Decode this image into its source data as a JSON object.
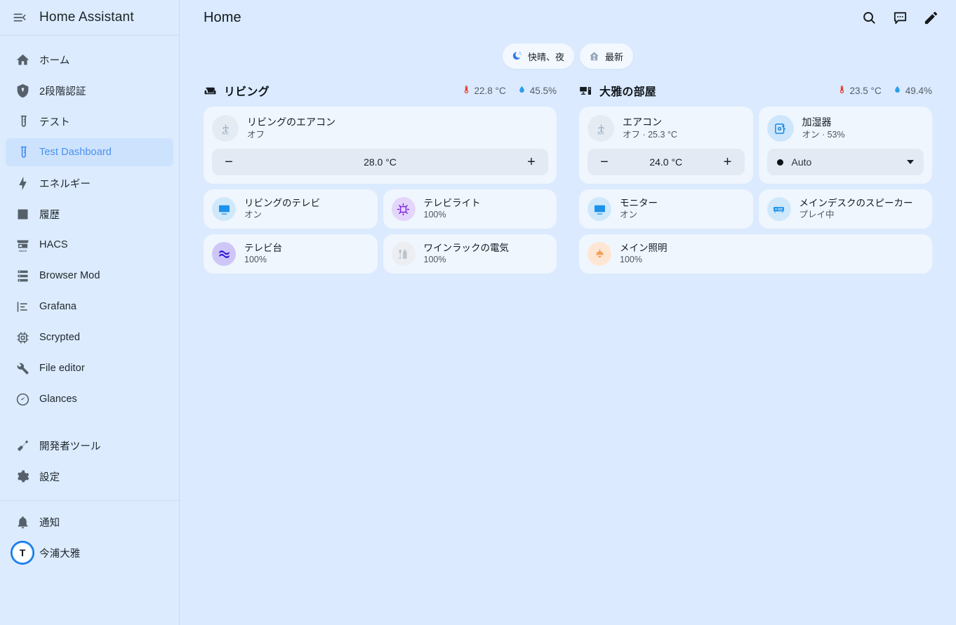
{
  "sidebar": {
    "title": "Home Assistant",
    "menu_icon": "menu-collapse-icon",
    "items": [
      {
        "label": "ホーム",
        "icon": "home-icon",
        "active": false
      },
      {
        "label": "2段階認証",
        "icon": "shield-lock-icon",
        "active": false
      },
      {
        "label": "テスト",
        "icon": "test-tube-icon",
        "active": false
      },
      {
        "label": "Test Dashboard",
        "icon": "test-tube-icon",
        "active": true
      },
      {
        "label": "エネルギー",
        "icon": "lightning-bolt-icon",
        "active": false
      },
      {
        "label": "履歴",
        "icon": "chart-bar-icon",
        "active": false
      },
      {
        "label": "HACS",
        "icon": "hacs-store-icon",
        "active": false
      },
      {
        "label": "Browser Mod",
        "icon": "server-icon",
        "active": false
      },
      {
        "label": "Grafana",
        "icon": "grafana-chart-icon",
        "active": false
      },
      {
        "label": "Scrypted",
        "icon": "chip-icon",
        "active": false
      },
      {
        "label": "File editor",
        "icon": "wrench-icon",
        "active": false
      },
      {
        "label": "Glances",
        "icon": "gauge-icon",
        "active": false
      }
    ],
    "tools": [
      {
        "label": "開発者ツール",
        "icon": "hammer-icon"
      },
      {
        "label": "設定",
        "icon": "gear-icon"
      }
    ],
    "bottom": [
      {
        "label": "通知",
        "icon": "bell-icon"
      }
    ],
    "user": {
      "label": "今浦大雅",
      "avatar_initials": "T",
      "avatar_icon": "user-avatar"
    }
  },
  "header": {
    "title": "Home",
    "actions": [
      {
        "name": "search-icon",
        "label": "search"
      },
      {
        "name": "assist-icon",
        "label": "assist"
      },
      {
        "name": "edit-pencil-icon",
        "label": "edit"
      }
    ]
  },
  "chips": [
    {
      "label": "快晴、夜",
      "icon": "weather-night-clear-icon",
      "color": "#2f7ae5"
    },
    {
      "label": "最新",
      "icon": "home-update-icon",
      "color": "#94a7bb"
    }
  ],
  "sections": [
    {
      "id": "living",
      "title": "リビング",
      "icon": "sofa-icon",
      "stats": [
        {
          "icon": "thermometer-icon",
          "value": "22.8 °C",
          "color": "#e8392e"
        },
        {
          "icon": "water-drop-icon",
          "value": "45.5%",
          "color": "#2f9fe8"
        }
      ],
      "thermostat": {
        "name": "リビングのエアコン",
        "state": "オフ",
        "icon": "air-conditioner-icon",
        "badge_style": "grey",
        "minus": "−",
        "value": "28.0 °C",
        "plus": "+"
      },
      "tiles": [
        {
          "name": "リビングのテレビ",
          "state": "オン",
          "icon": "television-icon",
          "badge_style": "blue-lt"
        },
        {
          "name": "テレビライト",
          "state": "100%",
          "icon": "led-strip-variant-icon",
          "badge_style": "purple"
        },
        {
          "name": "テレビ台",
          "state": "100%",
          "icon": "led-strip-icon",
          "badge_style": "purple-dk"
        },
        {
          "name": "ワインラックの電気",
          "state": "100%",
          "icon": "glass-wine-bottle-icon",
          "badge_style": "neutral"
        }
      ]
    },
    {
      "id": "masaya-room",
      "title": "大雅の部屋",
      "icon": "desktop-tower-monitor-icon",
      "stats": [
        {
          "icon": "thermometer-icon",
          "value": "23.5 °C",
          "color": "#e8392e"
        },
        {
          "icon": "water-drop-icon",
          "value": "49.4%",
          "color": "#2f9fe8"
        }
      ],
      "thermostat": {
        "name": "エアコン",
        "state": "オフ · 25.3 °C",
        "icon": "air-conditioner-icon",
        "badge_style": "grey",
        "minus": "−",
        "value": "24.0 °C",
        "plus": "+"
      },
      "humidifier": {
        "name": "加湿器",
        "state": "オン · 53%",
        "icon": "air-humidifier-icon",
        "badge_style": "blue",
        "mode": "Auto",
        "caret": "chevron-down-icon"
      },
      "tiles": [
        {
          "name": "モニター",
          "state": "オン",
          "icon": "monitor-icon",
          "badge_style": "blue-lt"
        },
        {
          "name": "メインデスクのスピーカー",
          "state": "プレイ中",
          "icon": "speaker-icon",
          "badge_style": "blue-lt"
        },
        {
          "name": "メイン照明",
          "state": "100%",
          "icon": "ceiling-light-icon",
          "badge_style": "orange"
        }
      ]
    }
  ],
  "colors": {
    "background": "#dbeafe",
    "sidebar": "#dcebfd",
    "card": "#f0f6fe",
    "control": "#e3eaf3",
    "accent": "#4a90ee",
    "temperature": "#e8392e",
    "humidity": "#2f9fe8"
  }
}
